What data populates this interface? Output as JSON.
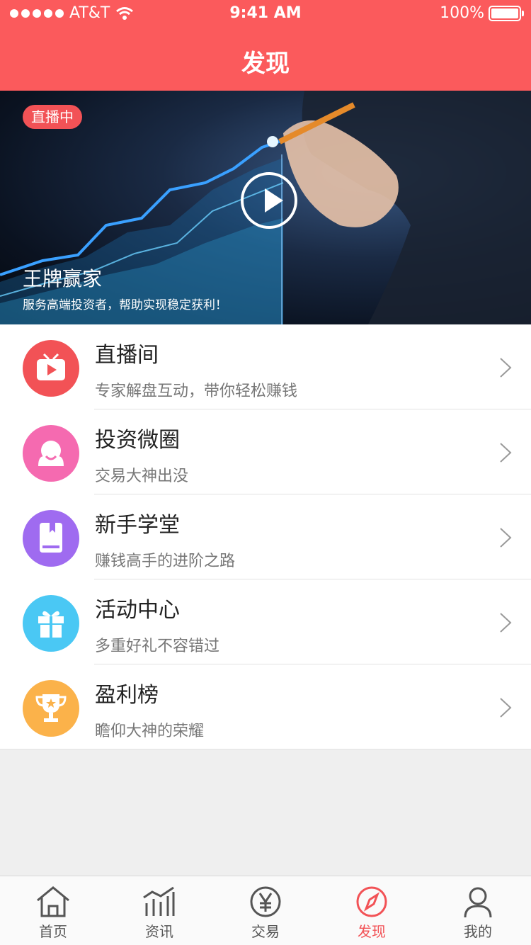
{
  "status": {
    "carrier": "AT&T",
    "time": "9:41 AM",
    "battery": "100%"
  },
  "header": {
    "title": "发现"
  },
  "banner": {
    "badge": "直播中",
    "title": "王牌赢家",
    "subtitle": "服务高端投资者，帮助实现稳定获利！"
  },
  "menu": [
    {
      "title": "直播间",
      "desc": "专家解盘互动，带你轻松赚钱",
      "icon": "tv-icon",
      "color": "#f25256"
    },
    {
      "title": "投资微圈",
      "desc": "交易大神出没",
      "icon": "people-icon",
      "color": "#f56ab0"
    },
    {
      "title": "新手学堂",
      "desc": "赚钱高手的进阶之路",
      "icon": "book-icon",
      "color": "#9f6bf0"
    },
    {
      "title": "活动中心",
      "desc": "多重好礼不容错过",
      "icon": "gift-icon",
      "color": "#4ac8f4"
    },
    {
      "title": "盈利榜",
      "desc": "瞻仰大神的荣耀",
      "icon": "trophy-icon",
      "color": "#fbb24a"
    }
  ],
  "tabs": [
    {
      "label": "首页",
      "icon": "home-icon"
    },
    {
      "label": "资讯",
      "icon": "chart-icon"
    },
    {
      "label": "交易",
      "icon": "yen-icon"
    },
    {
      "label": "发现",
      "icon": "compass-icon",
      "active": true
    },
    {
      "label": "我的",
      "icon": "user-icon"
    }
  ]
}
